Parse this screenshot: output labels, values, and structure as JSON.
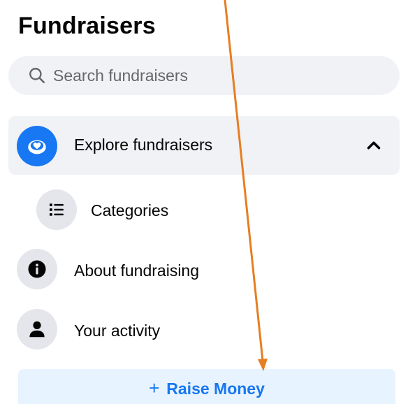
{
  "header": {
    "title": "Fundraisers"
  },
  "search": {
    "placeholder": "Search fundraisers"
  },
  "nav": {
    "explore": {
      "label": "Explore fundraisers",
      "icon": "donation-heart-icon",
      "expanded": true
    },
    "categories": {
      "label": "Categories",
      "icon": "list-icon"
    },
    "about": {
      "label": "About fundraising",
      "icon": "info-icon"
    },
    "activity": {
      "label": "Your activity",
      "icon": "person-icon"
    }
  },
  "cta": {
    "plus": "+",
    "label": "Raise Money"
  },
  "colors": {
    "accent": "#1877f2",
    "accent_light": "#e7f3ff",
    "surface": "#f0f2f5",
    "icon_bg": "#e4e6eb",
    "annotation_arrow": "#e67e22"
  }
}
